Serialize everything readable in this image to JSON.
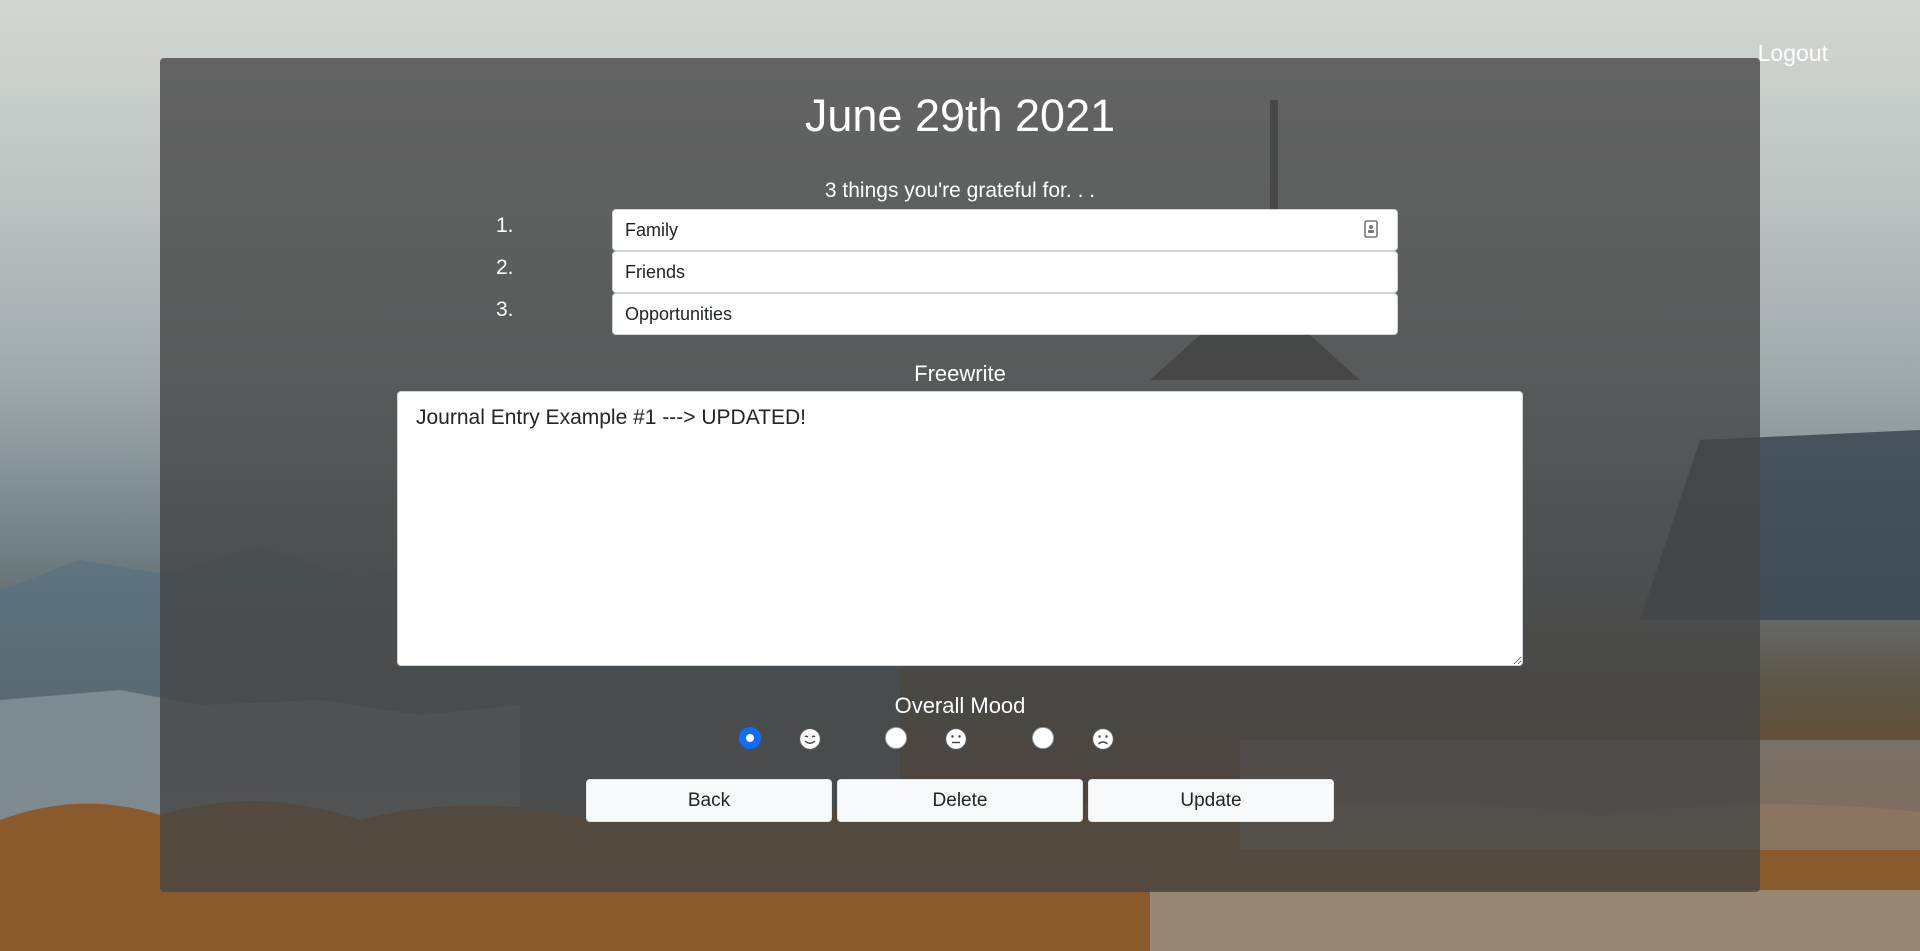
{
  "header": {
    "logout_label": "Logout"
  },
  "entry": {
    "date": "June 29th 2021",
    "grateful_title": "3 things you're grateful for. . .",
    "grateful_items": [
      {
        "number": "1.",
        "value": "Family"
      },
      {
        "number": "2.",
        "value": "Friends"
      },
      {
        "number": "3.",
        "value": "Opportunities"
      }
    ],
    "freewrite_label": "Freewrite",
    "freewrite_text": "Journal Entry Example #1 ---> UPDATED!",
    "mood_label": "Overall Mood",
    "mood_options": [
      {
        "icon": "smiling-face-icon",
        "selected": true
      },
      {
        "icon": "neutral-face-icon",
        "selected": false
      },
      {
        "icon": "frowning-face-icon",
        "selected": false
      }
    ]
  },
  "actions": {
    "back_label": "Back",
    "delete_label": "Delete",
    "update_label": "Update"
  },
  "colors": {
    "panel": "#444444",
    "accent": "#0d6efd",
    "button_bg": "#f8f9fa"
  }
}
